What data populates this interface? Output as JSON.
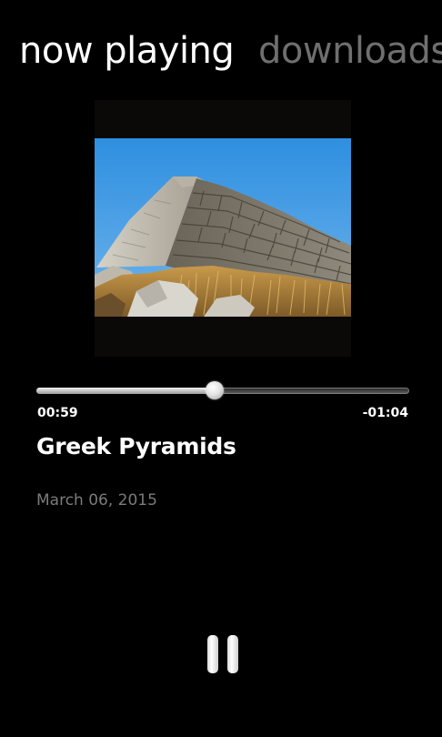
{
  "pivot": {
    "tabs": [
      {
        "label": "now playing",
        "active": true
      },
      {
        "label": "downloads",
        "active": false
      }
    ]
  },
  "player": {
    "artwork_icon": "pyramid-photo",
    "progress_fraction": 0.478,
    "elapsed": "00:59",
    "remaining": "-01:04",
    "title": "Greek Pyramids",
    "date": "March 06, 2015",
    "control_icon": "pause-icon"
  },
  "colors": {
    "background": "#000000",
    "active_text": "#ffffff",
    "inactive_text": "#6f6f6f",
    "date_text": "#7b7b7b"
  }
}
